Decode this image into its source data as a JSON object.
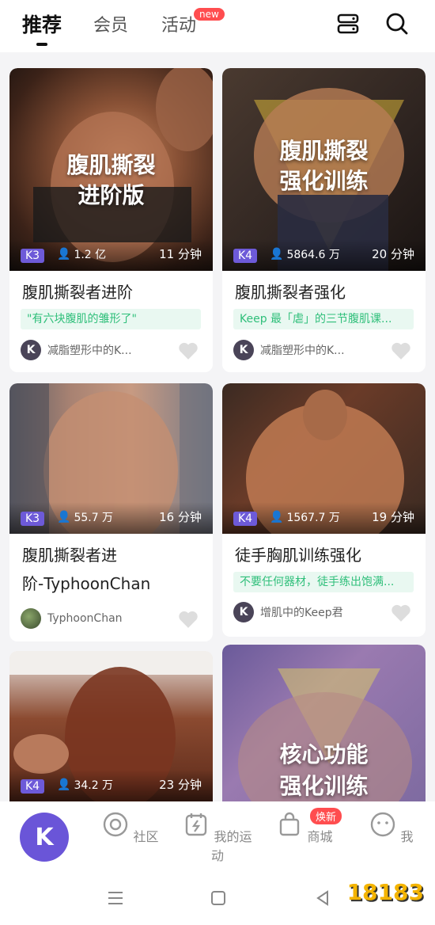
{
  "tabs": {
    "recommend": "推荐",
    "member": "会员",
    "activity": "活动",
    "activity_badge": "new"
  },
  "icons": {
    "layout": "layout-toggle-icon",
    "search": "search-icon"
  },
  "cards": [
    {
      "overlay": [
        "腹肌撕裂",
        "进阶版"
      ],
      "level": "K3",
      "views": "1.2 亿",
      "duration": "11 分钟",
      "title": "腹肌撕裂者进阶",
      "tagline": "\"有六块腹肌的雏形了\"",
      "author": "减脂塑形中的K...",
      "avatar_letter": "K"
    },
    {
      "overlay": [
        "腹肌撕裂",
        "强化训练"
      ],
      "level": "K4",
      "views": "5864.6 万",
      "duration": "20 分钟",
      "title": "腹肌撕裂者强化",
      "tagline": "Keep 最「虐」的三节腹肌课...",
      "author": "减脂塑形中的K...",
      "avatar_letter": "K"
    },
    {
      "overlay": [],
      "level": "K3",
      "views": "55.7 万",
      "duration": "16 分钟",
      "title_line1": "腹肌撕裂者进",
      "title_line2": "阶-TyphoonChan",
      "author": "TyphoonChan"
    },
    {
      "overlay": [],
      "level": "K4",
      "views": "1567.7 万",
      "duration": "19 分钟",
      "title": "徒手胸肌训练强化",
      "tagline": "不要任何器材，徒手练出饱满...",
      "author": "增肌中的Keep君",
      "avatar_letter": "K"
    },
    {
      "overlay": [],
      "level": "K4",
      "views": "34.2 万",
      "duration": "23 分钟"
    },
    {
      "overlay": [
        "核心功能",
        "强化训练"
      ]
    }
  ],
  "nav": {
    "keep": "K",
    "community": "社区",
    "my_sport": "我的运动",
    "mall": "商城",
    "mall_badge": "焕新",
    "me": "我"
  },
  "watermark": "18183",
  "colors": {
    "accent": "#6a55d8",
    "badge": "#ff4d4f",
    "tag_green": "#2fbf7a"
  }
}
